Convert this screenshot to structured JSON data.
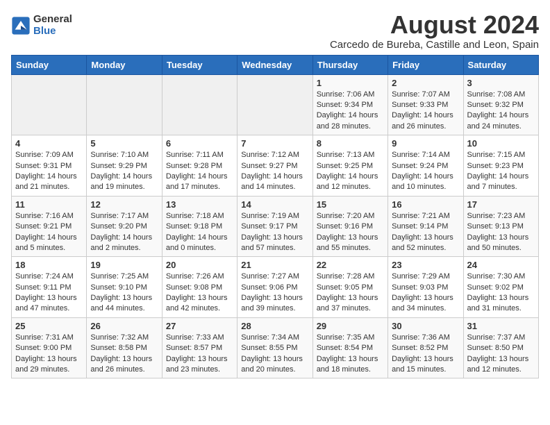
{
  "logo": {
    "general": "General",
    "blue": "Blue"
  },
  "title": "August 2024",
  "location": "Carcedo de Bureba, Castille and Leon, Spain",
  "days_of_week": [
    "Sunday",
    "Monday",
    "Tuesday",
    "Wednesday",
    "Thursday",
    "Friday",
    "Saturday"
  ],
  "weeks": [
    [
      {
        "day": "",
        "info": ""
      },
      {
        "day": "",
        "info": ""
      },
      {
        "day": "",
        "info": ""
      },
      {
        "day": "",
        "info": ""
      },
      {
        "day": "1",
        "sunrise": "7:06 AM",
        "sunset": "9:34 PM",
        "daylight": "14 hours and 28 minutes."
      },
      {
        "day": "2",
        "sunrise": "7:07 AM",
        "sunset": "9:33 PM",
        "daylight": "14 hours and 26 minutes."
      },
      {
        "day": "3",
        "sunrise": "7:08 AM",
        "sunset": "9:32 PM",
        "daylight": "14 hours and 24 minutes."
      }
    ],
    [
      {
        "day": "4",
        "sunrise": "7:09 AM",
        "sunset": "9:31 PM",
        "daylight": "14 hours and 21 minutes."
      },
      {
        "day": "5",
        "sunrise": "7:10 AM",
        "sunset": "9:29 PM",
        "daylight": "14 hours and 19 minutes."
      },
      {
        "day": "6",
        "sunrise": "7:11 AM",
        "sunset": "9:28 PM",
        "daylight": "14 hours and 17 minutes."
      },
      {
        "day": "7",
        "sunrise": "7:12 AM",
        "sunset": "9:27 PM",
        "daylight": "14 hours and 14 minutes."
      },
      {
        "day": "8",
        "sunrise": "7:13 AM",
        "sunset": "9:25 PM",
        "daylight": "14 hours and 12 minutes."
      },
      {
        "day": "9",
        "sunrise": "7:14 AM",
        "sunset": "9:24 PM",
        "daylight": "14 hours and 10 minutes."
      },
      {
        "day": "10",
        "sunrise": "7:15 AM",
        "sunset": "9:23 PM",
        "daylight": "14 hours and 7 minutes."
      }
    ],
    [
      {
        "day": "11",
        "sunrise": "7:16 AM",
        "sunset": "9:21 PM",
        "daylight": "14 hours and 5 minutes."
      },
      {
        "day": "12",
        "sunrise": "7:17 AM",
        "sunset": "9:20 PM",
        "daylight": "14 hours and 2 minutes."
      },
      {
        "day": "13",
        "sunrise": "7:18 AM",
        "sunset": "9:18 PM",
        "daylight": "14 hours and 0 minutes."
      },
      {
        "day": "14",
        "sunrise": "7:19 AM",
        "sunset": "9:17 PM",
        "daylight": "13 hours and 57 minutes."
      },
      {
        "day": "15",
        "sunrise": "7:20 AM",
        "sunset": "9:16 PM",
        "daylight": "13 hours and 55 minutes."
      },
      {
        "day": "16",
        "sunrise": "7:21 AM",
        "sunset": "9:14 PM",
        "daylight": "13 hours and 52 minutes."
      },
      {
        "day": "17",
        "sunrise": "7:23 AM",
        "sunset": "9:13 PM",
        "daylight": "13 hours and 50 minutes."
      }
    ],
    [
      {
        "day": "18",
        "sunrise": "7:24 AM",
        "sunset": "9:11 PM",
        "daylight": "13 hours and 47 minutes."
      },
      {
        "day": "19",
        "sunrise": "7:25 AM",
        "sunset": "9:10 PM",
        "daylight": "13 hours and 44 minutes."
      },
      {
        "day": "20",
        "sunrise": "7:26 AM",
        "sunset": "9:08 PM",
        "daylight": "13 hours and 42 minutes."
      },
      {
        "day": "21",
        "sunrise": "7:27 AM",
        "sunset": "9:06 PM",
        "daylight": "13 hours and 39 minutes."
      },
      {
        "day": "22",
        "sunrise": "7:28 AM",
        "sunset": "9:05 PM",
        "daylight": "13 hours and 37 minutes."
      },
      {
        "day": "23",
        "sunrise": "7:29 AM",
        "sunset": "9:03 PM",
        "daylight": "13 hours and 34 minutes."
      },
      {
        "day": "24",
        "sunrise": "7:30 AM",
        "sunset": "9:02 PM",
        "daylight": "13 hours and 31 minutes."
      }
    ],
    [
      {
        "day": "25",
        "sunrise": "7:31 AM",
        "sunset": "9:00 PM",
        "daylight": "13 hours and 29 minutes."
      },
      {
        "day": "26",
        "sunrise": "7:32 AM",
        "sunset": "8:58 PM",
        "daylight": "13 hours and 26 minutes."
      },
      {
        "day": "27",
        "sunrise": "7:33 AM",
        "sunset": "8:57 PM",
        "daylight": "13 hours and 23 minutes."
      },
      {
        "day": "28",
        "sunrise": "7:34 AM",
        "sunset": "8:55 PM",
        "daylight": "13 hours and 20 minutes."
      },
      {
        "day": "29",
        "sunrise": "7:35 AM",
        "sunset": "8:54 PM",
        "daylight": "13 hours and 18 minutes."
      },
      {
        "day": "30",
        "sunrise": "7:36 AM",
        "sunset": "8:52 PM",
        "daylight": "13 hours and 15 minutes."
      },
      {
        "day": "31",
        "sunrise": "7:37 AM",
        "sunset": "8:50 PM",
        "daylight": "13 hours and 12 minutes."
      }
    ]
  ],
  "labels": {
    "sunrise": "Sunrise:",
    "sunset": "Sunset:",
    "daylight": "Daylight:"
  }
}
